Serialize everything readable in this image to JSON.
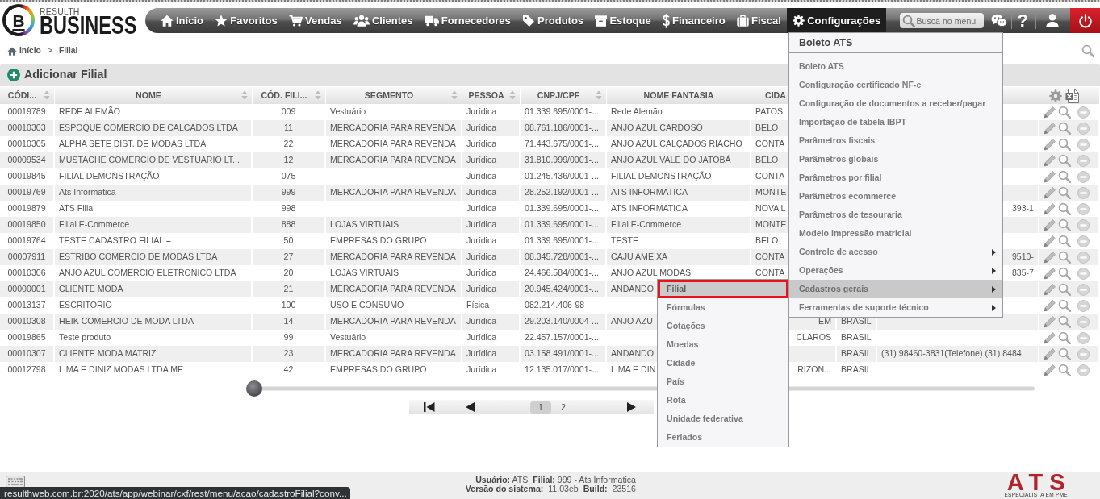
{
  "logo": {
    "letter": "B",
    "subtitle": "RESULTH",
    "title": "BUSINESS"
  },
  "nav": {
    "items": [
      {
        "label": "Início",
        "selected": false
      },
      {
        "label": "Favoritos",
        "selected": false
      },
      {
        "label": "Vendas",
        "selected": false
      },
      {
        "label": "Clientes",
        "selected": false
      },
      {
        "label": "Fornecedores",
        "selected": false
      },
      {
        "label": "Produtos",
        "selected": false
      },
      {
        "label": "Estoque",
        "selected": false
      },
      {
        "label": "Financeiro",
        "selected": false
      },
      {
        "label": "Fiscal",
        "selected": false
      },
      {
        "label": "Configurações",
        "selected": true
      }
    ],
    "search": {
      "placeholder": "Busca no menu"
    },
    "help": "?"
  },
  "config_menu": {
    "title": "Boleto ATS",
    "items": [
      {
        "label": "Boleto ATS",
        "has_submenu": false,
        "expanded": false
      },
      {
        "label": "Configuração certificado NF-e",
        "has_submenu": false,
        "expanded": false
      },
      {
        "label": "Configuração de documentos a receber/pagar",
        "has_submenu": false,
        "expanded": false
      },
      {
        "label": "Importação de tabela IBPT",
        "has_submenu": false,
        "expanded": false
      },
      {
        "label": "Parâmetros fiscais",
        "has_submenu": false,
        "expanded": false
      },
      {
        "label": "Parâmetros globais",
        "has_submenu": false,
        "expanded": false
      },
      {
        "label": "Parâmetros por filial",
        "has_submenu": false,
        "expanded": false
      },
      {
        "label": "Parâmetros ecommerce",
        "has_submenu": false,
        "expanded": false
      },
      {
        "label": "Parâmetros de tesouraria",
        "has_submenu": false,
        "expanded": false
      },
      {
        "label": "Modelo impressão matricial",
        "has_submenu": false,
        "expanded": false
      },
      {
        "label": "Controle de acesso",
        "has_submenu": true,
        "expanded": false
      },
      {
        "label": "Operações",
        "has_submenu": true,
        "expanded": false
      },
      {
        "label": "Cadastros gerais",
        "has_submenu": true,
        "expanded": true,
        "children": [
          {
            "label": "Filial",
            "selected": true,
            "outlined": true
          },
          {
            "label": "Fórmulas",
            "selected": false,
            "outlined": false
          },
          {
            "label": "Cotações",
            "selected": false,
            "outlined": false
          },
          {
            "label": "Moedas",
            "selected": false,
            "outlined": false
          },
          {
            "label": "Cidade",
            "selected": false,
            "outlined": false
          },
          {
            "label": "País",
            "selected": false,
            "outlined": false
          },
          {
            "label": "Rota",
            "selected": false,
            "outlined": false
          },
          {
            "label": "Unidade federativa",
            "selected": false,
            "outlined": false
          },
          {
            "label": "Feriados",
            "selected": false,
            "outlined": false
          }
        ]
      },
      {
        "label": "Ferramentas de suporte técnico",
        "has_submenu": true,
        "expanded": false
      }
    ]
  },
  "breadcrumb": {
    "items": [
      "Início",
      "Filial"
    ],
    "separator": ">"
  },
  "toolbar": {
    "add_button": "Adicionar Filial"
  },
  "table": {
    "columns": [
      {
        "label": "CÓDI...",
        "sortable": true,
        "cut_right": false
      },
      {
        "label": "NOME",
        "sortable": true,
        "cut_right": false
      },
      {
        "label": "CÓD. FILI...",
        "sortable": true,
        "cut_right": false
      },
      {
        "label": "SEGMENTO",
        "sortable": true,
        "cut_right": false
      },
      {
        "label": "PESSOA",
        "sortable": true,
        "cut_right": false
      },
      {
        "label": "CNPJ/CPF",
        "sortable": true,
        "cut_right": false
      },
      {
        "label": "NOME FANTASIA",
        "sortable": false,
        "cut_right": false
      },
      {
        "label": "CIDA",
        "sortable": false,
        "cut_right": true
      }
    ],
    "rows": [
      {
        "column_1": "00019789",
        "nome": "REDE ALEMÃO",
        "column_3": "009",
        "segmento": "Vestuário",
        "pessoa": "Jurídica",
        "cnpj_cpf": "01.339.695/0001-...",
        "nome_fantasia": "Rede Alemão",
        "column_8": "PATOS"
      },
      {
        "column_1": "00010303",
        "nome": "ESPOQUE COMERCIO DE CALCADOS LTDA",
        "column_3": "11",
        "segmento": "MERCADORIA PARA REVENDA",
        "pessoa": "Jurídica",
        "cnpj_cpf": "08.761.186/0001-...",
        "nome_fantasia": "ANJO AZUL CARDOSO",
        "column_8": "BELO"
      },
      {
        "column_1": "00010305",
        "nome": "ALPHA SETE DIST. DE MODAS LTDA",
        "column_3": "22",
        "segmento": "MERCADORIA PARA REVENDA",
        "pessoa": "Jurídica",
        "cnpj_cpf": "71.443.675/0001-...",
        "nome_fantasia": "ANJO AZUL CALÇADOS RIACHO",
        "column_8": "CONTA"
      },
      {
        "column_1": "00009534",
        "nome": "MUSTACHE COMERCIO DE VESTUARIO LT...",
        "column_3": "12",
        "segmento": "MERCADORIA PARA REVENDA",
        "pessoa": "Jurídica",
        "cnpj_cpf": "31.810.999/0001-...",
        "nome_fantasia": "ANJO AZUL VALE DO JATOBÁ",
        "column_8": "BELO"
      },
      {
        "column_1": "00019845",
        "nome": "FILIAL DEMONSTRAÇÃO",
        "column_3": "075",
        "pessoa": "Jurídica",
        "cnpj_cpf": "01.245.436/0001-...",
        "nome_fantasia": "FILIAL DEMONSTRAÇÃO",
        "column_8": "CONTA"
      },
      {
        "column_1": "00019769",
        "nome": "Ats Informatica",
        "column_3": "999",
        "segmento": "MERCADORIA PARA REVENDA",
        "pessoa": "Jurídica",
        "cnpj_cpf": "28.252.192/0001-...",
        "nome_fantasia": "ATS INFORMATICA",
        "column_8": "MONTE"
      },
      {
        "column_1": "00019879",
        "nome": "ATS Filial",
        "column_3": "998",
        "pessoa": "Jurídica",
        "cnpj_cpf": "01.339.695/0001-...",
        "nome_fantasia": "ATS INFORMATICA",
        "column_8": "NOVA L",
        "column_10": {
          "text": "393-1",
          "cut_left": true
        }
      },
      {
        "column_1": "00019850",
        "nome": "Filial E-Commerce",
        "column_3": "888",
        "segmento": "LOJAS VIRTUAIS",
        "pessoa": "Jurídica",
        "cnpj_cpf": "01.339.695/0001-...",
        "nome_fantasia": "Filial E-Commerce",
        "column_8": "MONTE"
      },
      {
        "column_1": "00019764",
        "nome": "TESTE CADASTRO FILIAL =",
        "column_3": "50",
        "segmento": "EMPRESAS DO GRUPO",
        "pessoa": "Jurídica",
        "cnpj_cpf": "01.339.695/0001-...",
        "nome_fantasia": "TESTE",
        "column_8": "BELO"
      },
      {
        "column_1": "00007911",
        "nome": "ESTRIBO COMERCIO DE MODAS LTDA",
        "column_3": "27",
        "segmento": "MERCADORIA PARA REVENDA",
        "pessoa": "Jurídica",
        "cnpj_cpf": "08.345.728/0001-...",
        "nome_fantasia": "CAJU AMEIXA",
        "column_8": "CONTA",
        "column_10": {
          "text": "9510-",
          "cut_left": true
        }
      },
      {
        "column_1": "00010306",
        "nome": "ANJO AZUL COMERCIO ELETRONICO LTDA",
        "column_3": "20",
        "segmento": "LOJAS VIRTUAIS",
        "pessoa": "Jurídica",
        "cnpj_cpf": "24.466.584/0001-...",
        "nome_fantasia": "ANJO AZUL MODAS",
        "column_8": "CONTA",
        "column_10": {
          "text": "835-7",
          "cut_left": true
        }
      },
      {
        "column_1": "00000001",
        "nome": "CLIENTE MODA",
        "column_3": "21",
        "segmento": "MERCADORIA PARA REVENDA",
        "pessoa": "Jurídica",
        "cnpj_cpf": "20.945.424/0001-...",
        "nome_fantasia": "ANDANDO"
      },
      {
        "column_1": "00013137",
        "nome": "ESCRITORIO",
        "column_3": "100",
        "segmento": "USO E CONSUMO",
        "pessoa": "Física",
        "cnpj_cpf": "082.214.406-98"
      },
      {
        "column_1": "00010308",
        "nome": "HEIK COMERCIO DE MODA LTDA",
        "column_3": "14",
        "segmento": "MERCADORIA PARA REVENDA",
        "pessoa": "Jurídica",
        "cnpj_cpf": "29.203.140/0004-...",
        "nome_fantasia": "ANJO AZU",
        "column_8": {
          "text": "EM",
          "cut_left": true
        },
        "column_9": "BRASIL"
      },
      {
        "column_1": "00019865",
        "nome": "Teste produto",
        "column_3": "99",
        "segmento": "Vestuário",
        "pessoa": "Jurídica",
        "cnpj_cpf": "22.457.157/0001-...",
        "column_8": {
          "text": "CLAROS",
          "cut_left": true
        },
        "column_9": "BRASIL"
      },
      {
        "column_1": "00010307",
        "nome": "CLIENTE MODA MATRIZ",
        "column_3": "23",
        "segmento": "MERCADORIA PARA REVENDA",
        "pessoa": "Jurídica",
        "cnpj_cpf": "03.158.491/0001-...",
        "nome_fantasia": "ANDANDO",
        "column_9": "BRASIL",
        "column_10": "(31) 98460-3831(Telefone) (31) 8484"
      },
      {
        "column_1": "00012798",
        "nome": "LIMA E DINIZ MODAS LTDA ME",
        "column_3": "42",
        "segmento": "EMPRESAS DO GRUPO",
        "pessoa": "Jurídica",
        "cnpj_cpf": "12.135.017/0001-...",
        "nome_fantasia": "LIMA E DIN",
        "column_8": {
          "text": "RIZON...",
          "cut_left": true
        },
        "column_9": "BRASIL"
      }
    ]
  },
  "pagination": {
    "pages": [
      {
        "label": "1",
        "selected": true
      },
      {
        "label": "2",
        "selected": false
      }
    ]
  },
  "footer": {
    "lines": [
      "**Usuário:** ATS  **Filial:** 999 - Ats Informatica",
      "**Versão do sistema:**  11.03eb  **Build:**  23516"
    ],
    "brand": "ATS",
    "tagline": "ESPECIALISTA EM PME"
  },
  "status_url": "resulthweb.com.br:2020/ats/app/webinar/cxf/rest/menu/acao/cadastroFilial?conv..."
}
